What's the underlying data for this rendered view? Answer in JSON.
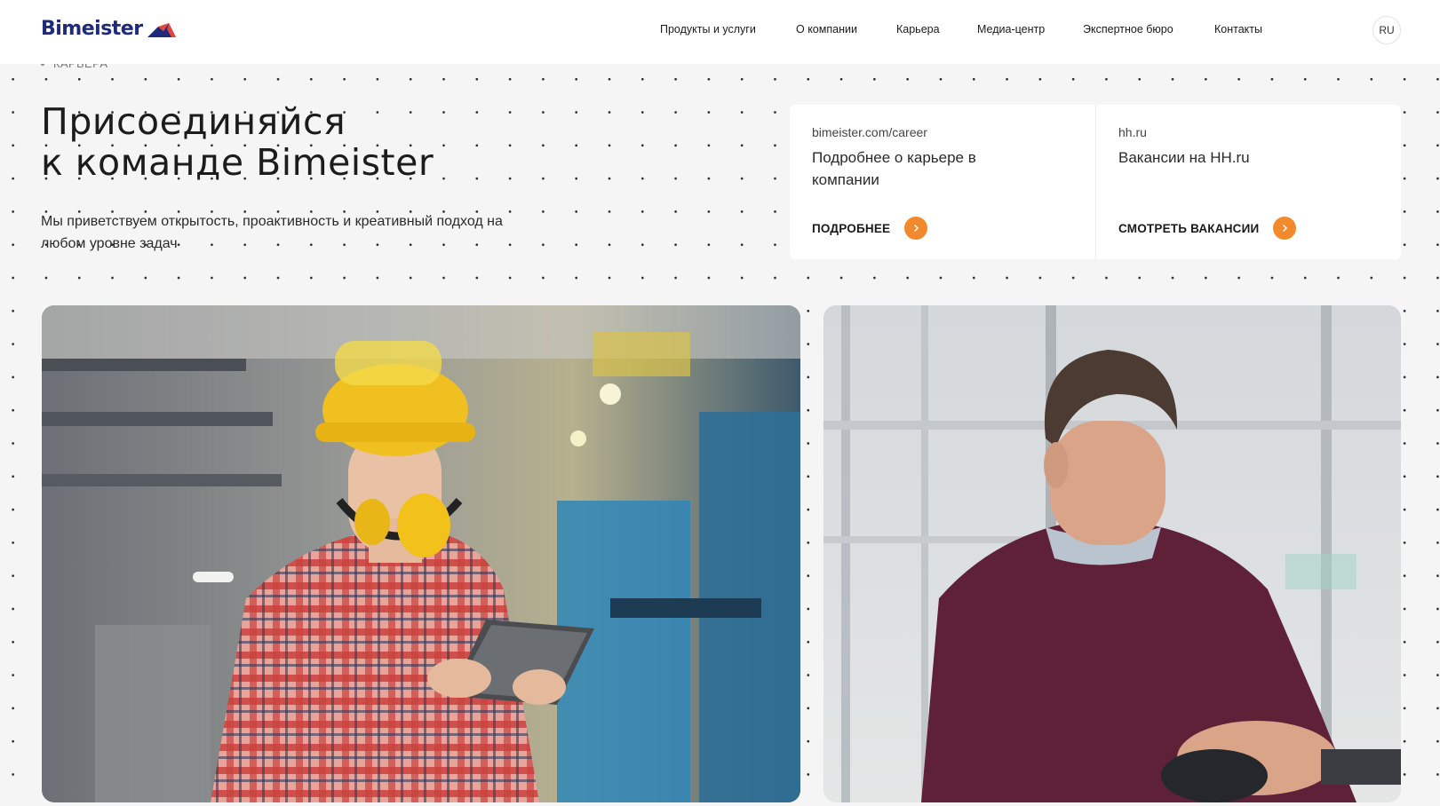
{
  "header": {
    "logo_text": "Bimeister",
    "nav": [
      {
        "label": "Продукты и услуги"
      },
      {
        "label": "О компании"
      },
      {
        "label": "Карьера"
      },
      {
        "label": "Медиа-центр"
      },
      {
        "label": "Экспертное бюро"
      },
      {
        "label": "Контакты"
      }
    ],
    "lang": "RU"
  },
  "breadcrumb": "КАРЬЕРА",
  "hero": {
    "title_line1": "Присоединяйся",
    "title_line2": "к команде Bimeister",
    "subtitle": "Мы приветствуем открытость, проактивность и креативный подход на любом уровне задач"
  },
  "cards": [
    {
      "url": "bimeister.com/career",
      "description": "Подробнее о карьере в компании",
      "cta": "ПОДРОБНЕЕ"
    },
    {
      "url": "hh.ru",
      "description": "Вакансии на HH.ru",
      "cta": "СМОТРЕТЬ ВАКАНСИИ"
    }
  ],
  "colors": {
    "accent": "#f28a2d",
    "brand": "#1f2a7a",
    "background": "#f5f5f5"
  },
  "photos": [
    {
      "name": "woman-engineer-photo"
    },
    {
      "name": "man-at-computer-photo"
    }
  ]
}
